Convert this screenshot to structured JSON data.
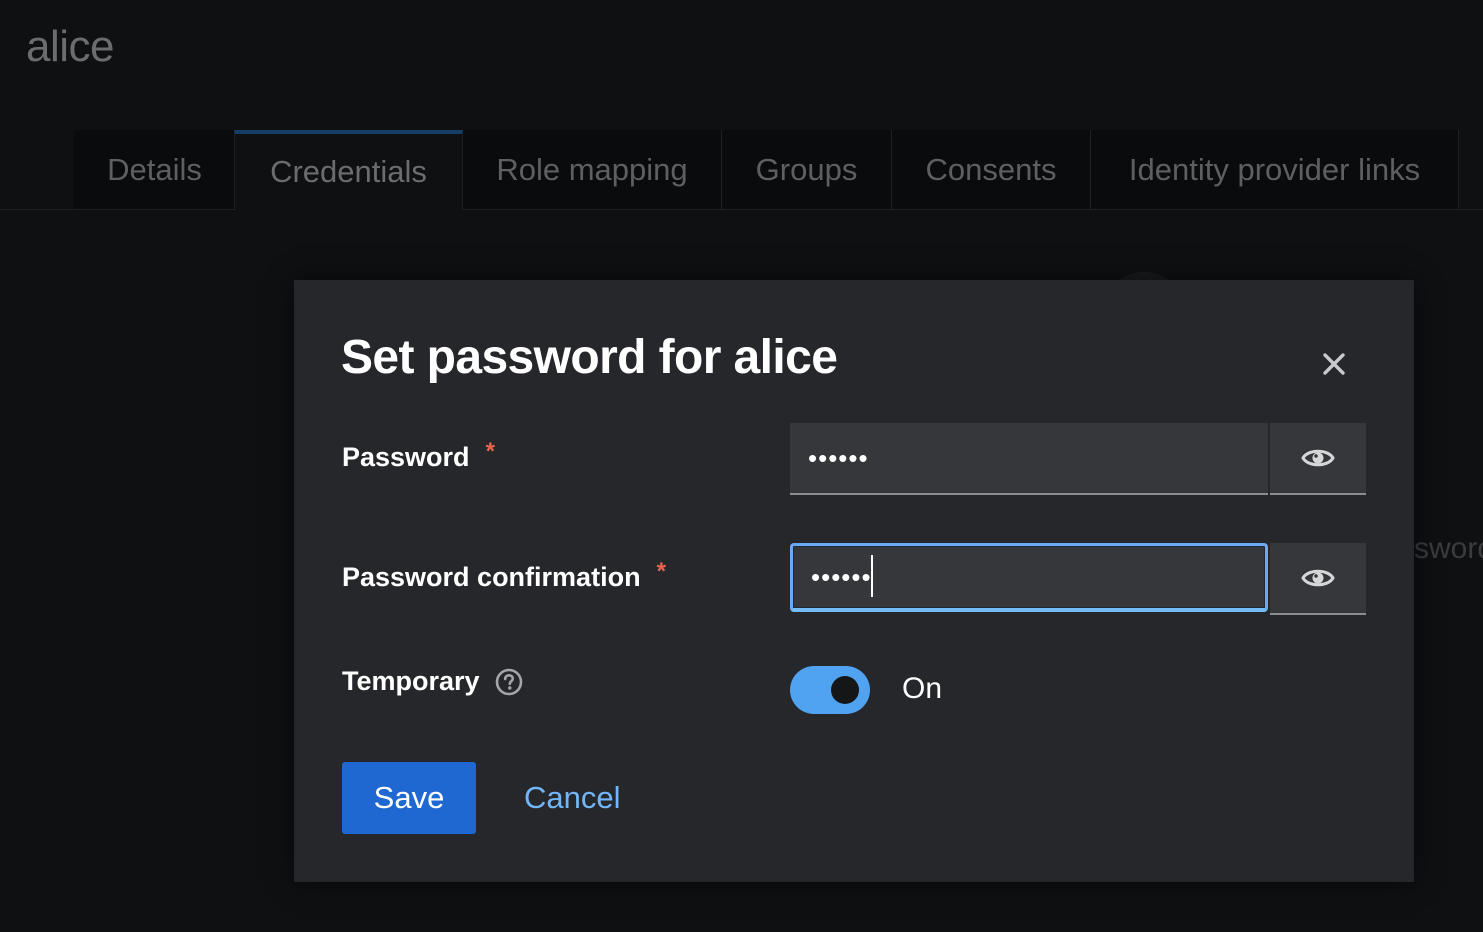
{
  "page": {
    "title": "alice"
  },
  "tabs": [
    {
      "label": "Details"
    },
    {
      "label": "Credentials"
    },
    {
      "label": "Role mapping"
    },
    {
      "label": "Groups"
    },
    {
      "label": "Consents"
    },
    {
      "label": "Identity provider links"
    }
  ],
  "background": {
    "peek_text": "sword"
  },
  "modal": {
    "title": "Set password for alice",
    "password": {
      "label": "Password",
      "required_marker": "*",
      "value": "••••••",
      "show_icon": "eye-icon"
    },
    "password_confirmation": {
      "label": "Password confirmation",
      "required_marker": "*",
      "value": "••••••",
      "show_icon": "eye-icon"
    },
    "temporary": {
      "label": "Temporary",
      "help_icon": "help-circle-icon",
      "state": true,
      "state_label": "On"
    },
    "save_label": "Save",
    "cancel_label": "Cancel",
    "close_icon": "close-icon"
  },
  "colors": {
    "primary": "#1f67d1",
    "link": "#73b6f7",
    "toggle_on": "#4fa3f0",
    "required": "#e9654b",
    "modal_bg": "#26272b"
  }
}
